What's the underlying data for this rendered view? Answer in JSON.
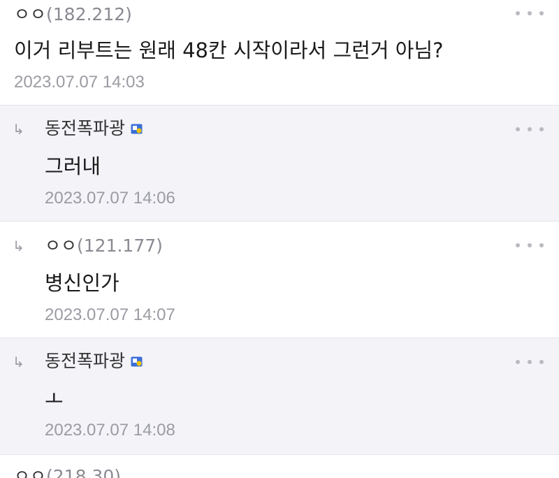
{
  "comments": [
    {
      "author_prefix": "ㅇㅇ",
      "author_ip": "(182.212)",
      "text": "이거 리부트는 원래 48칸 시작이라서 그런거 아님?",
      "timestamp": "2023.07.07 14:03"
    },
    {
      "reply_arrow": "↳",
      "author_nick": "동전폭파광",
      "text": "그러내",
      "timestamp": "2023.07.07 14:06"
    },
    {
      "reply_arrow": "↳",
      "author_prefix": "ㅇㅇ",
      "author_ip": "(121.177)",
      "text": "병신인가",
      "timestamp": "2023.07.07 14:07"
    },
    {
      "reply_arrow": "↳",
      "author_nick": "동전폭파광",
      "text": "ㅗ",
      "timestamp": "2023.07.07 14:08"
    },
    {
      "author_prefix": "ㅇㅇ",
      "author_ip": "(218.30)"
    }
  ],
  "colors": {
    "reply_bg": "#f3f3f8",
    "text_muted": "#9b9ba3",
    "badge_blue": "#3b6fd8",
    "badge_yellow": "#f2c200"
  },
  "icons": {
    "more": "more-dots-icon",
    "badge": "gallog-badge-icon",
    "reply": "reply-arrow-icon"
  }
}
